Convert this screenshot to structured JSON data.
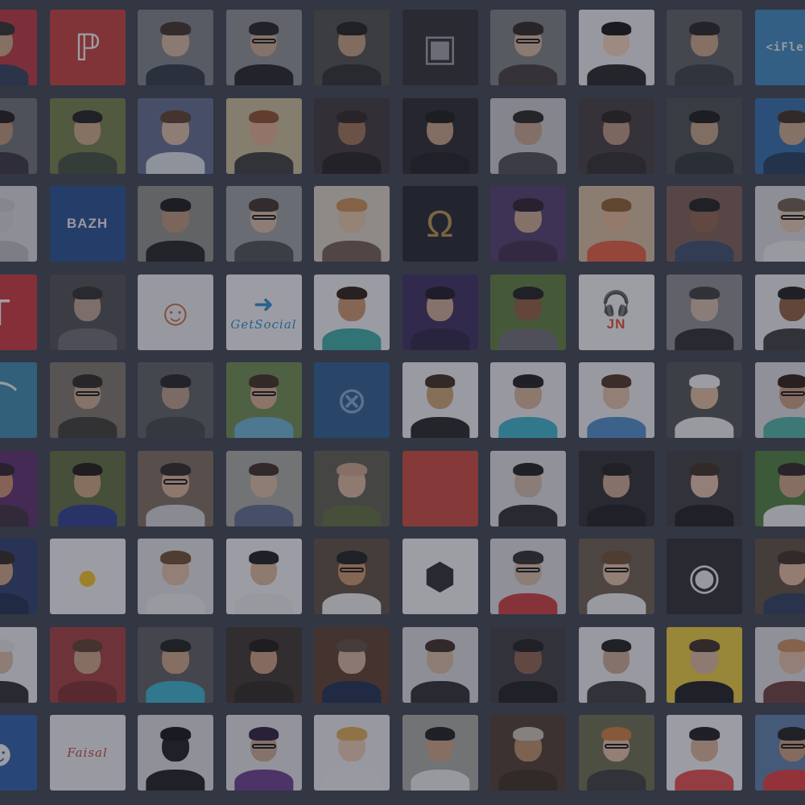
{
  "colors": {
    "background": "#3c3e4a",
    "overlay": "#282a3a"
  },
  "tiles": [
    {
      "kind": "person",
      "bg": "#b8323c",
      "skin": "#c9a37f",
      "hair": "#2a2a2a",
      "shirt": "#2f3b55"
    },
    {
      "kind": "logo",
      "bg": "#c23b37",
      "glyph": "ℙ",
      "glyphColor": "#f0f0f0",
      "icon": "p-logo-icon"
    },
    {
      "kind": "person",
      "bg": "#7d7f84",
      "skin": "#d2b39a",
      "hair": "#3b2e25",
      "shirt": "#2d3440"
    },
    {
      "kind": "person",
      "bg": "#8c8e90",
      "skin": "#c8a68a",
      "hair": "#1e1e1e",
      "shirt": "#1f1f22",
      "glasses": true
    },
    {
      "kind": "person",
      "bg": "#4a4a48",
      "skin": "#c29c7a",
      "hair": "#1a1a1a",
      "shirt": "#2a2a2a"
    },
    {
      "kind": "logo",
      "bg": "#2a2a2e",
      "glyph": "▣",
      "glyphColor": "#9c9ca2",
      "icon": "band-photo-icon"
    },
    {
      "kind": "person",
      "bg": "#7a7c80",
      "skin": "#d4b19a",
      "hair": "#2a211b",
      "shirt": "#3e3a38",
      "glasses": true
    },
    {
      "kind": "person",
      "bg": "#e8e8ea",
      "skin": "#f2d1b6",
      "hair": "#111111",
      "shirt": "#222222"
    },
    {
      "kind": "person",
      "bg": "#5a5c60",
      "skin": "#c8a382",
      "hair": "#202020",
      "shirt": "#3a3c40"
    },
    {
      "kind": "logo",
      "bg": "#3a86b8",
      "text": "<iFlend",
      "textStyle": "mono",
      "icon": "iflend-logo-icon"
    },
    {
      "kind": "person",
      "bg": "#6a6c72",
      "skin": "#b98f74",
      "hair": "#1a1414",
      "shirt": "#35303a"
    },
    {
      "kind": "person",
      "bg": "#6f7a44",
      "skin": "#caa482",
      "hair": "#1a1a1a",
      "shirt": "#3f4a38"
    },
    {
      "kind": "person",
      "bg": "#5e6a8a",
      "skin": "#d9b8a0",
      "hair": "#5a3a2a",
      "shirt": "#d8dce2"
    },
    {
      "kind": "person",
      "bg": "#c8b894",
      "skin": "#e0a98a",
      "hair": "#8a4a2a",
      "shirt": "#3a3a3a"
    },
    {
      "kind": "person",
      "bg": "#3a3434",
      "skin": "#9c6f52",
      "hair": "#2a1f1a",
      "shirt": "#1f1c1c"
    },
    {
      "kind": "person",
      "bg": "#242428",
      "skin": "#c59c80",
      "hair": "#151515",
      "shirt": "#1a1a1c"
    },
    {
      "kind": "person",
      "bg": "#c8c8ca",
      "skin": "#c4a08a",
      "hair": "#222",
      "shirt": "#4a4a4c"
    },
    {
      "kind": "person",
      "bg": "#3e3a3a",
      "skin": "#b8917a",
      "hair": "#241c18",
      "shirt": "#2c2828"
    },
    {
      "kind": "person",
      "bg": "#454a4a",
      "skin": "#c29f80",
      "hair": "#151515",
      "shirt": "#2a3232"
    },
    {
      "kind": "person",
      "bg": "#2d6aa8",
      "skin": "#c9a688",
      "hair": "#3a2a20",
      "shirt": "#1f3a5a"
    },
    {
      "kind": "person",
      "bg": "#d8d8da",
      "skin": "#d0d0d4",
      "hair": "#c8c8cc",
      "shirt": "#b8b8bc"
    },
    {
      "kind": "logo",
      "bg": "#234a8c",
      "text": "BAZH",
      "textStyle": "bold",
      "icon": "bazh-logo-icon"
    },
    {
      "kind": "person",
      "bg": "#8a8c84",
      "skin": "#b88f74",
      "hair": "#151515",
      "shirt": "#1f1f1f"
    },
    {
      "kind": "person",
      "bg": "#9a9c9e",
      "skin": "#d6b8a2",
      "hair": "#3a2e26",
      "shirt": "#4a4c50",
      "glasses": true
    },
    {
      "kind": "person",
      "bg": "#d8cfc0",
      "skin": "#e6c3a4",
      "hair": "#c48a52",
      "shirt": "#6e5a4a"
    },
    {
      "kind": "logo",
      "bg": "#1e1f2a",
      "glyph": "Ω",
      "glyphColor": "#b88f4a",
      "icon": "laurel-omega-icon"
    },
    {
      "kind": "person",
      "bg": "#4a3a6a",
      "skin": "#c8a48a",
      "hair": "#2a1a2a",
      "shirt": "#3a2a4a"
    },
    {
      "kind": "person",
      "bg": "#d2b89a",
      "skin": "#e0b48e",
      "hair": "#8a5a2a",
      "shirt": "#e05a3a"
    },
    {
      "kind": "person",
      "bg": "#7a5a52",
      "skin": "#8a6048",
      "hair": "#1a1a1a",
      "shirt": "#3a4a6a"
    },
    {
      "kind": "person",
      "bg": "#d8d8da",
      "skin": "#e0c4ae",
      "hair": "#6a5a4a",
      "shirt": "#eaeaea",
      "glasses": true
    },
    {
      "kind": "logo",
      "bg": "#c8323a",
      "glyph": "T",
      "glyphColor": "#f4f4f4",
      "icon": "t-logo-icon"
    },
    {
      "kind": "person",
      "bg": "#4a4a4c",
      "skin": "#b8a090",
      "hair": "#2a2a2a",
      "shirt": "#6a6a6c"
    },
    {
      "kind": "logo",
      "bg": "#e8e8ea",
      "glyph": "☺",
      "glyphColor": "#c86a3a",
      "icon": "duck-mascot-icon"
    },
    {
      "kind": "logo",
      "bg": "#f0f0f2",
      "text": "GetSocial",
      "textStyle": "script",
      "textColor": "#2a8ac8",
      "glyph": "➜",
      "glyphColor": "#2a8ac8",
      "icon": "getsocial-logo-icon"
    },
    {
      "kind": "person",
      "bg": "#eeeeef",
      "skin": "#c8926a",
      "hair": "#2a1a10",
      "shirt": "#3aa8a0"
    },
    {
      "kind": "person",
      "bg": "#3a2a5a",
      "skin": "#c8a890",
      "hair": "#1a1420",
      "shirt": "#2a2040"
    },
    {
      "kind": "person",
      "bg": "#5a7a3a",
      "skin": "#8a5a3a",
      "hair": "#1a1a1a",
      "shirt": "#6a6a70"
    },
    {
      "kind": "logo",
      "bg": "#f2f2f2",
      "glyph": "🎧",
      "glyphColor": "#e04a2a",
      "text": "JN",
      "textStyle": "bold",
      "textColor": "#e04a2a",
      "icon": "headphones-logo-icon"
    },
    {
      "kind": "person",
      "bg": "#8a8a8c",
      "skin": "#d0b8a8",
      "hair": "#3a3a3a",
      "shirt": "#2a2a2c"
    },
    {
      "kind": "person",
      "bg": "#e8e8ea",
      "skin": "#8a5a3a",
      "hair": "#1a1a1a",
      "shirt": "#3a3a3a"
    },
    {
      "kind": "logo",
      "bg": "#3a86a8",
      "glyph": "⌒",
      "glyphColor": "#e0e8ee",
      "icon": "bridge-icon"
    },
    {
      "kind": "person",
      "bg": "#7a7268",
      "skin": "#c8a88e",
      "hair": "#2a2420",
      "shirt": "#3a3630",
      "glasses": true
    },
    {
      "kind": "person",
      "bg": "#5a5c5e",
      "skin": "#b89a86",
      "hair": "#202020",
      "shirt": "#404244"
    },
    {
      "kind": "person",
      "bg": "#6a8a4a",
      "skin": "#d4aa8a",
      "hair": "#3a2a1a",
      "shirt": "#6ab0d0",
      "glasses": true
    },
    {
      "kind": "logo",
      "bg": "#2a5a8a",
      "glyph": "⊗",
      "glyphColor": "#7aa8d0",
      "icon": "circle-cross-logo-icon"
    },
    {
      "kind": "person",
      "bg": "#ececee",
      "skin": "#c8a070",
      "hair": "#3a2a1a",
      "shirt": "#222222"
    },
    {
      "kind": "person",
      "bg": "#e8e8ea",
      "skin": "#d6b094",
      "hair": "#1a1a1a",
      "shirt": "#3ab0c8"
    },
    {
      "kind": "person",
      "bg": "#eaeaec",
      "skin": "#e0bca0",
      "hair": "#4a3020",
      "shirt": "#4a8ac8"
    },
    {
      "kind": "person",
      "bg": "#4a5050",
      "skin": "#e0b89a",
      "hair": "#f0f0f0",
      "shirt": "#eaeaea"
    },
    {
      "kind": "person",
      "bg": "#dadadc",
      "skin": "#c89a7a",
      "hair": "#2a1a10",
      "shirt": "#4ab0a0",
      "glasses": true
    },
    {
      "kind": "person",
      "bg": "#5a2a6a",
      "skin": "#c88a6a",
      "hair": "#2a1a2a",
      "shirt": "#3a2a3a"
    },
    {
      "kind": "person",
      "bg": "#5a6a3a",
      "skin": "#c8a07a",
      "hair": "#1a1410",
      "shirt": "#2a3a8a"
    },
    {
      "kind": "person",
      "bg": "#7a6a5a",
      "skin": "#d6b094",
      "hair": "#2a2420",
      "shirt": "#d0d0d2",
      "glasses": true
    },
    {
      "kind": "person",
      "bg": "#a8a8a0",
      "skin": "#d8b8a0",
      "hair": "#3a2a20",
      "shirt": "#5a6a8a"
    },
    {
      "kind": "person",
      "bg": "#5a5a4a",
      "skin": "#d8b49a",
      "hair": "#c8a088",
      "shirt": "#5a6a3a"
    },
    {
      "kind": "logo",
      "bg": "#c8453a",
      "icon": "red-square-icon"
    },
    {
      "kind": "person",
      "bg": "#dcdcde",
      "skin": "#d0b8a8",
      "hair": "#1a1a1a",
      "shirt": "#2a2a2a"
    },
    {
      "kind": "person",
      "bg": "#2a2a2c",
      "skin": "#c8a48a",
      "hair": "#1a1a1a",
      "shirt": "#1a1a1c"
    },
    {
      "kind": "person",
      "bg": "#3a3a3c",
      "skin": "#e0bca4",
      "hair": "#3a2a20",
      "shirt": "#1a1a1a"
    },
    {
      "kind": "person",
      "bg": "#4a7a3a",
      "skin": "#c8a080",
      "hair": "#2a2020",
      "shirt": "#eaeaea"
    },
    {
      "kind": "person",
      "bg": "#2a3a6a",
      "skin": "#c8a080",
      "hair": "#2a2420",
      "shirt": "#1a2a4a"
    },
    {
      "kind": "logo",
      "bg": "#f0f0f2",
      "glyph": "●",
      "glyphColor": "#f0c020",
      "icon": "surprised-emoji-icon"
    },
    {
      "kind": "person",
      "bg": "#e0e0e2",
      "skin": "#e0bca0",
      "hair": "#6a4a2a",
      "shirt": "#eaeaea"
    },
    {
      "kind": "person",
      "bg": "#f0f0f2",
      "skin": "#d8b494",
      "hair": "#1a1a1a",
      "shirt": "#e8e8e8"
    },
    {
      "kind": "person",
      "bg": "#5a4a3a",
      "skin": "#c8926a",
      "hair": "#1a1a1a",
      "shirt": "#eaeaea",
      "glasses": true
    },
    {
      "kind": "logo",
      "bg": "#f2f2f2",
      "glyph": "⬢",
      "glyphColor": "#2a2a2c",
      "icon": "hexagon-menu-logo-icon"
    },
    {
      "kind": "person",
      "bg": "#dadadc",
      "skin": "#d4b8a4",
      "hair": "#2a2a2a",
      "shirt": "#c83a3a",
      "glasses": true
    },
    {
      "kind": "person",
      "bg": "#6a5a4a",
      "skin": "#e0bca0",
      "hair": "#6a4a2a",
      "shirt": "#eaeaea",
      "glasses": true
    },
    {
      "kind": "logo",
      "bg": "#2a2a2c",
      "glyph": "◉",
      "glyphColor": "#e8e8ea",
      "icon": "eye-logo-icon"
    },
    {
      "kind": "person",
      "bg": "#5a4a3a",
      "skin": "#e0b89a",
      "hair": "#3a2a20",
      "shirt": "#2a3a5a"
    },
    {
      "kind": "person",
      "bg": "#eaeaec",
      "skin": "#d8b8a0",
      "hair": "#e0e0e0",
      "shirt": "#2a2a2a"
    },
    {
      "kind": "person",
      "bg": "#a03a3a",
      "skin": "#c8a080",
      "hair": "#5a3a2a",
      "shirt": "#7a2a2a"
    },
    {
      "kind": "person",
      "bg": "#5a5a5c",
      "skin": "#c8a080",
      "hair": "#1a1a1a",
      "shirt": "#3ab0c8"
    },
    {
      "kind": "person",
      "bg": "#3a3028",
      "skin": "#c89a7a",
      "hair": "#1a1410",
      "shirt": "#2a2420"
    },
    {
      "kind": "person",
      "bg": "#5a3a2a",
      "skin": "#d4b098",
      "hair": "#5a4a3a",
      "shirt": "#1a2a4a"
    },
    {
      "kind": "person",
      "bg": "#d8d8da",
      "skin": "#d8b8a0",
      "hair": "#3a2a20",
      "shirt": "#2a2a2c"
    },
    {
      "kind": "person",
      "bg": "#3a3a3c",
      "skin": "#8a6048",
      "hair": "#1a1a1a",
      "shirt": "#1a1a1a"
    },
    {
      "kind": "person",
      "bg": "#eaeaec",
      "skin": "#c8a890",
      "hair": "#1a1a1a",
      "shirt": "#3a3a3a"
    },
    {
      "kind": "person",
      "bg": "#e8c83a",
      "skin": "#d8b49a",
      "hair": "#3a2a20",
      "shirt": "#1a1a1c"
    },
    {
      "kind": "person",
      "bg": "#dadadc",
      "skin": "#e0bca0",
      "hair": "#c88a5a",
      "shirt": "#6a3a3a"
    },
    {
      "kind": "logo",
      "bg": "#2a5aa8",
      "glyph": "☻",
      "glyphColor": "#f0f0f0",
      "icon": "bearded-mascot-icon"
    },
    {
      "kind": "logo",
      "bg": "#eaeaec",
      "text": "Faisal",
      "textStyle": "script",
      "textColor": "#c83a3a",
      "icon": "faisal-logo-icon"
    },
    {
      "kind": "person",
      "bg": "#dadadc",
      "skin": "#1a1a1c",
      "hair": "#111111",
      "shirt": "#1a1a1a"
    },
    {
      "kind": "person",
      "bg": "#e0e0e2",
      "skin": "#c8a890",
      "hair": "#2a1a3a",
      "shirt": "#6a3a8a",
      "glasses": true
    },
    {
      "kind": "person",
      "bg": "#e8e8ea",
      "skin": "#e8c8b0",
      "hair": "#d8a850",
      "shirt": "#eaeaea"
    },
    {
      "kind": "person",
      "bg": "#a8a8a0",
      "skin": "#c8a080",
      "hair": "#1a1a1a",
      "shirt": "#e8e8e8"
    },
    {
      "kind": "person",
      "bg": "#4a3a2a",
      "skin": "#b88a62",
      "hair": "#c8c0b0",
      "shirt": "#3a2a1a"
    },
    {
      "kind": "person",
      "bg": "#6a6a4a",
      "skin": "#e0bca0",
      "hair": "#c87a3a",
      "shirt": "#3a3a3a",
      "glasses": true
    },
    {
      "kind": "person",
      "bg": "#f0f0f2",
      "skin": "#d8b094",
      "hair": "#1a1a1a",
      "shirt": "#e04a4a"
    },
    {
      "kind": "person",
      "bg": "#5a7aa8",
      "skin": "#c89a7a",
      "hair": "#1a1a1a",
      "shirt": "#e03a3a",
      "glasses": true
    }
  ]
}
